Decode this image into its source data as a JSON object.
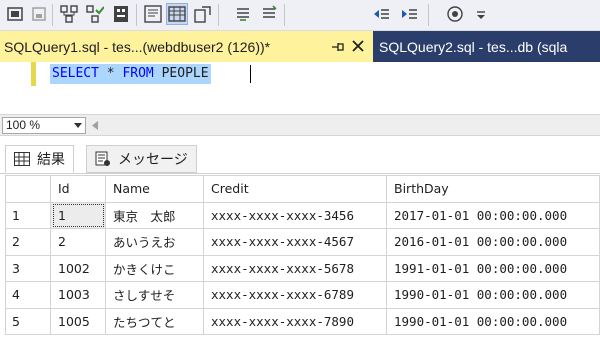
{
  "toolbar": {
    "buttons": [
      {
        "icon": "results-to-file-icon"
      },
      {
        "icon": "disabled-icon"
      },
      {
        "icon": "debug-icon"
      },
      {
        "icon": "parse-icon"
      },
      {
        "icon": "query-options-icon"
      },
      {
        "icon": "results-to-text-icon"
      },
      {
        "icon": "results-to-grid-icon",
        "active": true
      },
      {
        "icon": "results-to-file-alt-icon"
      },
      {
        "icon": "comment-icon"
      },
      {
        "icon": "uncomment-icon"
      },
      {
        "icon": "decrease-indent-icon"
      },
      {
        "icon": "increase-indent-icon"
      },
      {
        "icon": "specify-values-icon"
      },
      {
        "icon": "overflow-icon"
      }
    ]
  },
  "tabs": {
    "active": {
      "label": "SQLQuery1.sql - tes...(webdbuser2 (126))*",
      "pin_glyph": "⊣",
      "close_glyph": "✕"
    },
    "inactive": {
      "label": "SQLQuery2.sql - tes...db (sqla"
    }
  },
  "editor": {
    "keyword1": "SELECT",
    "star": " * ",
    "keyword2": "FROM",
    "table": " PEOPLE"
  },
  "zoom": {
    "value": "100 %"
  },
  "result_tabs": {
    "results": "結果",
    "messages": "メッセージ"
  },
  "grid": {
    "columns": [
      "",
      "Id",
      "Name",
      "Credit",
      "BirthDay"
    ],
    "rows": [
      {
        "num": "1",
        "id": "1",
        "name": "東京　太郎",
        "credit": "xxxx-xxxx-xxxx-3456",
        "birthday": "2017-01-01 00:00:00.000"
      },
      {
        "num": "2",
        "id": "2",
        "name": "あいうえお",
        "credit": "xxxx-xxxx-xxxx-4567",
        "birthday": "2016-01-01 00:00:00.000"
      },
      {
        "num": "3",
        "id": "1002",
        "name": "かきくけこ",
        "credit": "xxxx-xxxx-xxxx-5678",
        "birthday": "1991-01-01 00:00:00.000"
      },
      {
        "num": "4",
        "id": "1003",
        "name": "さしすせそ",
        "credit": "xxxx-xxxx-xxxx-6789",
        "birthday": "1990-01-01 00:00:00.000"
      },
      {
        "num": "5",
        "id": "1005",
        "name": "たちつてと",
        "credit": "xxxx-xxxx-xxxx-7890",
        "birthday": "1990-01-01 00:00:00.000"
      }
    ]
  },
  "colors": {
    "active_tab": "#fff29d",
    "tab_strip": "#2b3e6b",
    "keyword": "#0000ff",
    "selection": "#add6ff"
  }
}
